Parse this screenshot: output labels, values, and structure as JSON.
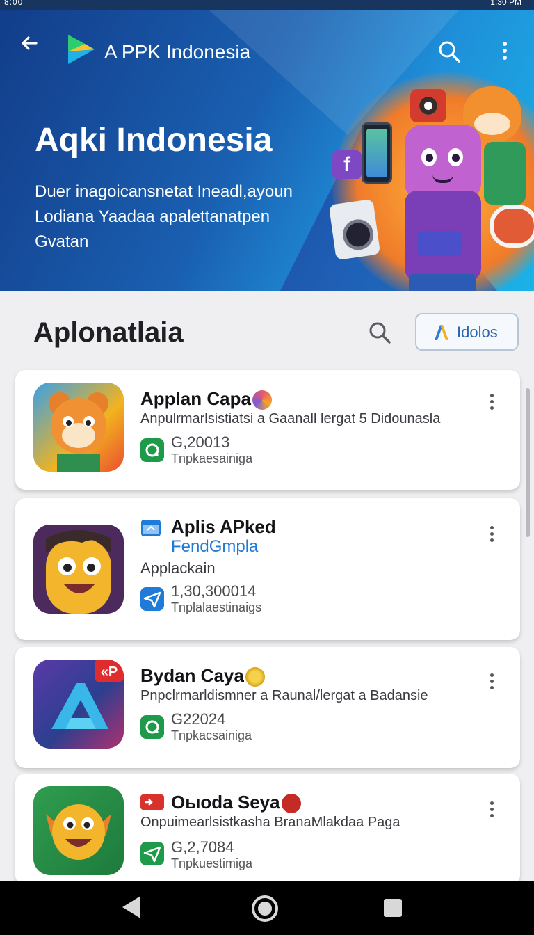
{
  "status_bar": {
    "left_text": "8:00",
    "right_text": "1:30 PM"
  },
  "app_bar": {
    "title": "A PPK Indonesia"
  },
  "hero": {
    "title": "Aqki Indonesia",
    "subtitle_lines": [
      "Duer inagoicansnetat Ineadl,ayoun",
      "Lodiana Yaadaa apalettanatpen",
      "Gvatan"
    ]
  },
  "section": {
    "title": "Aplonatlaia",
    "filter_label": "Idolos"
  },
  "apps": [
    {
      "name": "Applan Capa",
      "line1": "Anpulrmarlsistiatsi a Gaanall lergat 5 Didounasla",
      "line2": "",
      "count": "G,20013",
      "meta": "Tnpkaesainiga",
      "meta_color": "#1e9a4a"
    },
    {
      "name": "Aplis APked",
      "line1": "FendGmpla",
      "line2": "Applackain",
      "count": "1,30,300014",
      "meta": "Tnplalaestinaigs",
      "meta_color": "#1f7ad8"
    },
    {
      "name": "Bydan Caya",
      "line1": "Pnpclrmarldismner a Raunal/lergat a Badansie",
      "line2": "",
      "count": "G22024",
      "meta": "Tnpkacsainiga",
      "meta_color": "#1e9a4a"
    },
    {
      "name": "Oыoda Seya",
      "line1": "Onpuimearlsistkasha BranaMlakdaa Paga",
      "line2": "",
      "count": "G,2,7084",
      "meta": "Tnpkuestimiga",
      "meta_color": "#1e9a4a"
    }
  ],
  "icon_badges": [
    "«P",
    "P"
  ],
  "colors": {
    "hero_start": "#123d8a",
    "hero_end": "#1ab3e8",
    "accent_blue": "#2b66b0",
    "green": "#1e9a4a",
    "background": "#efeff1"
  },
  "icons": [
    "back-arrow-icon",
    "app-logo-icon",
    "search-icon",
    "more-vert-icon",
    "filter-logo-icon",
    "nav-back-icon",
    "nav-home-icon",
    "nav-recents-icon"
  ]
}
